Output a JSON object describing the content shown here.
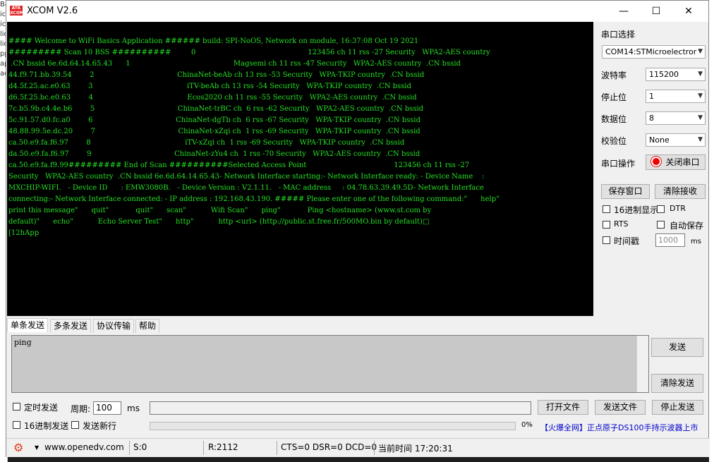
{
  "window": {
    "title": "XCOM V2.6",
    "app_icon_text": "ATK\nXCOM"
  },
  "terminal": {
    "lines": [
      "#### Welcome to WiFi Basics Application ###### build: SPI-NoOS, Network on module, 16:37:08 Oct 19 2021",
      "######### Scan 10 BSS ##########         0                                                  123456 ch 11 rss -27 Security   WPA2-AES country",
      " .CN bssid 6e.6d.64.14.65.43      1                                              Magsemi ch 11 rss -47 Security   WPA2-AES country  .CN bssid",
      "44.f9.71.bb.39.54        2                                     ChinaNet-beAb ch 13 rss -53 Security   WPA-TKIP country  .CN bssid",
      "d4.5f.25.ac.e0.63        3                                          iTV-beAb ch 13 rss -54 Security   WPA-TKIP country  .CN bssid",
      "d6.5f.25.bc.e0.63        4                                          Ecos2020 ch 11 rss -55 Security   WPA2-AES country  .CN bssid",
      "7c.b5.9b.c4.4e.b6        5                                     ChinaNet-trBC ch  6 rss -62 Security   WPA2-AES country  .CN bssid",
      "5c.91.57.d0.fc.a0        6                                     ChinaNet-dgTb ch  6 rss -67 Security   WPA-TKIP country  .CN bssid",
      "48.88.99.5e.dc.20        7                                     ChinaNet-xZqi ch  1 rss -69 Security   WPA-TKIP country  .CN bssid",
      "ca.50.e9.fa.f6.97        8                                          iTV-xZqi ch  1 rss -69 Security   WPA-TKIP country  .CN bssid",
      "da.50.e9.fa.f6.97        9                                     ChinaNet-zYu4 ch  1 rss -70 Security   WPA2-AES country  .CN bssid",
      "ca.50.e9.fa.f9.99######### End of Scan ##########Selected Access Point                                       123456 ch 11 rss -27",
      "Security   WPA2-AES country  .CN bssid 6e.6d.64.14.65.43- Network Interface starting:- Network Interface ready: - Device Name    :",
      "MXCHIP-WIFI.   - Device ID      : EMW3080B.   - Device Version : V2.1.11.   - MAC address     : 04.78.63.39.49.5D- Network Interface",
      "connecting:- Network Interface connected: - IP address : 192.168.43.190. ##### Please enter one of the following command:\"      help\"",
      "print this message\"      quit\"            quit\"      scan\"           Wifi Scan\"      ping\"            Ping <hostname> (www.st.com by",
      "default)\"      echo\"           Echo Server Test\"      http\"           http <url> (http://public.st.free.fr/500MO.bin by default)□",
      "[12hApp"
    ]
  },
  "side": {
    "port_select_label": "串口选择",
    "port_value": "COM14:STMicroelectror",
    "baud_label": "波特率",
    "baud_value": "115200",
    "stopbits_label": "停止位",
    "stopbits_value": "1",
    "databits_label": "数据位",
    "databits_value": "8",
    "parity_label": "校验位",
    "parity_value": "None",
    "port_op_label": "串口操作",
    "close_port_button": "关闭串口",
    "save_window_button": "保存窗口",
    "clear_recv_button": "清除接收",
    "hex_display_label": "16进制显示",
    "dtr_label": "DTR",
    "rts_label": "RTS",
    "auto_save_label": "自动保存",
    "timestamp_label": "时间戳",
    "timestamp_value": "1000",
    "timestamp_unit": "ms"
  },
  "tabs": [
    "单条发送",
    "多条发送",
    "协议传输",
    "帮助"
  ],
  "send": {
    "text": "ping",
    "send_button": "发送",
    "clear_send_button": "清除发送",
    "timed_send_label": "定时发送",
    "period_label": "周期:",
    "period_value": "100",
    "period_unit": "ms",
    "open_file_button": "打开文件",
    "send_file_button": "发送文件",
    "stop_send_button": "停止发送",
    "hex_send_label": "16进制发送",
    "send_newline_label": "发送新行",
    "progress_text": "0%",
    "progress": 0,
    "ad_text": "【火爆全网】正点原子DS100手持示波器上市"
  },
  "status": {
    "url": "www.openedv.com",
    "s_count": "S:0",
    "r_count": "R:2112",
    "lines": "CTS=0 DSR=0 DCD=0",
    "time": "当前时间 17:20:31"
  },
  "colors": {
    "terminal_text": "#25e025",
    "terminal_bg": "#000000",
    "ad_blue": "#0000cc"
  }
}
